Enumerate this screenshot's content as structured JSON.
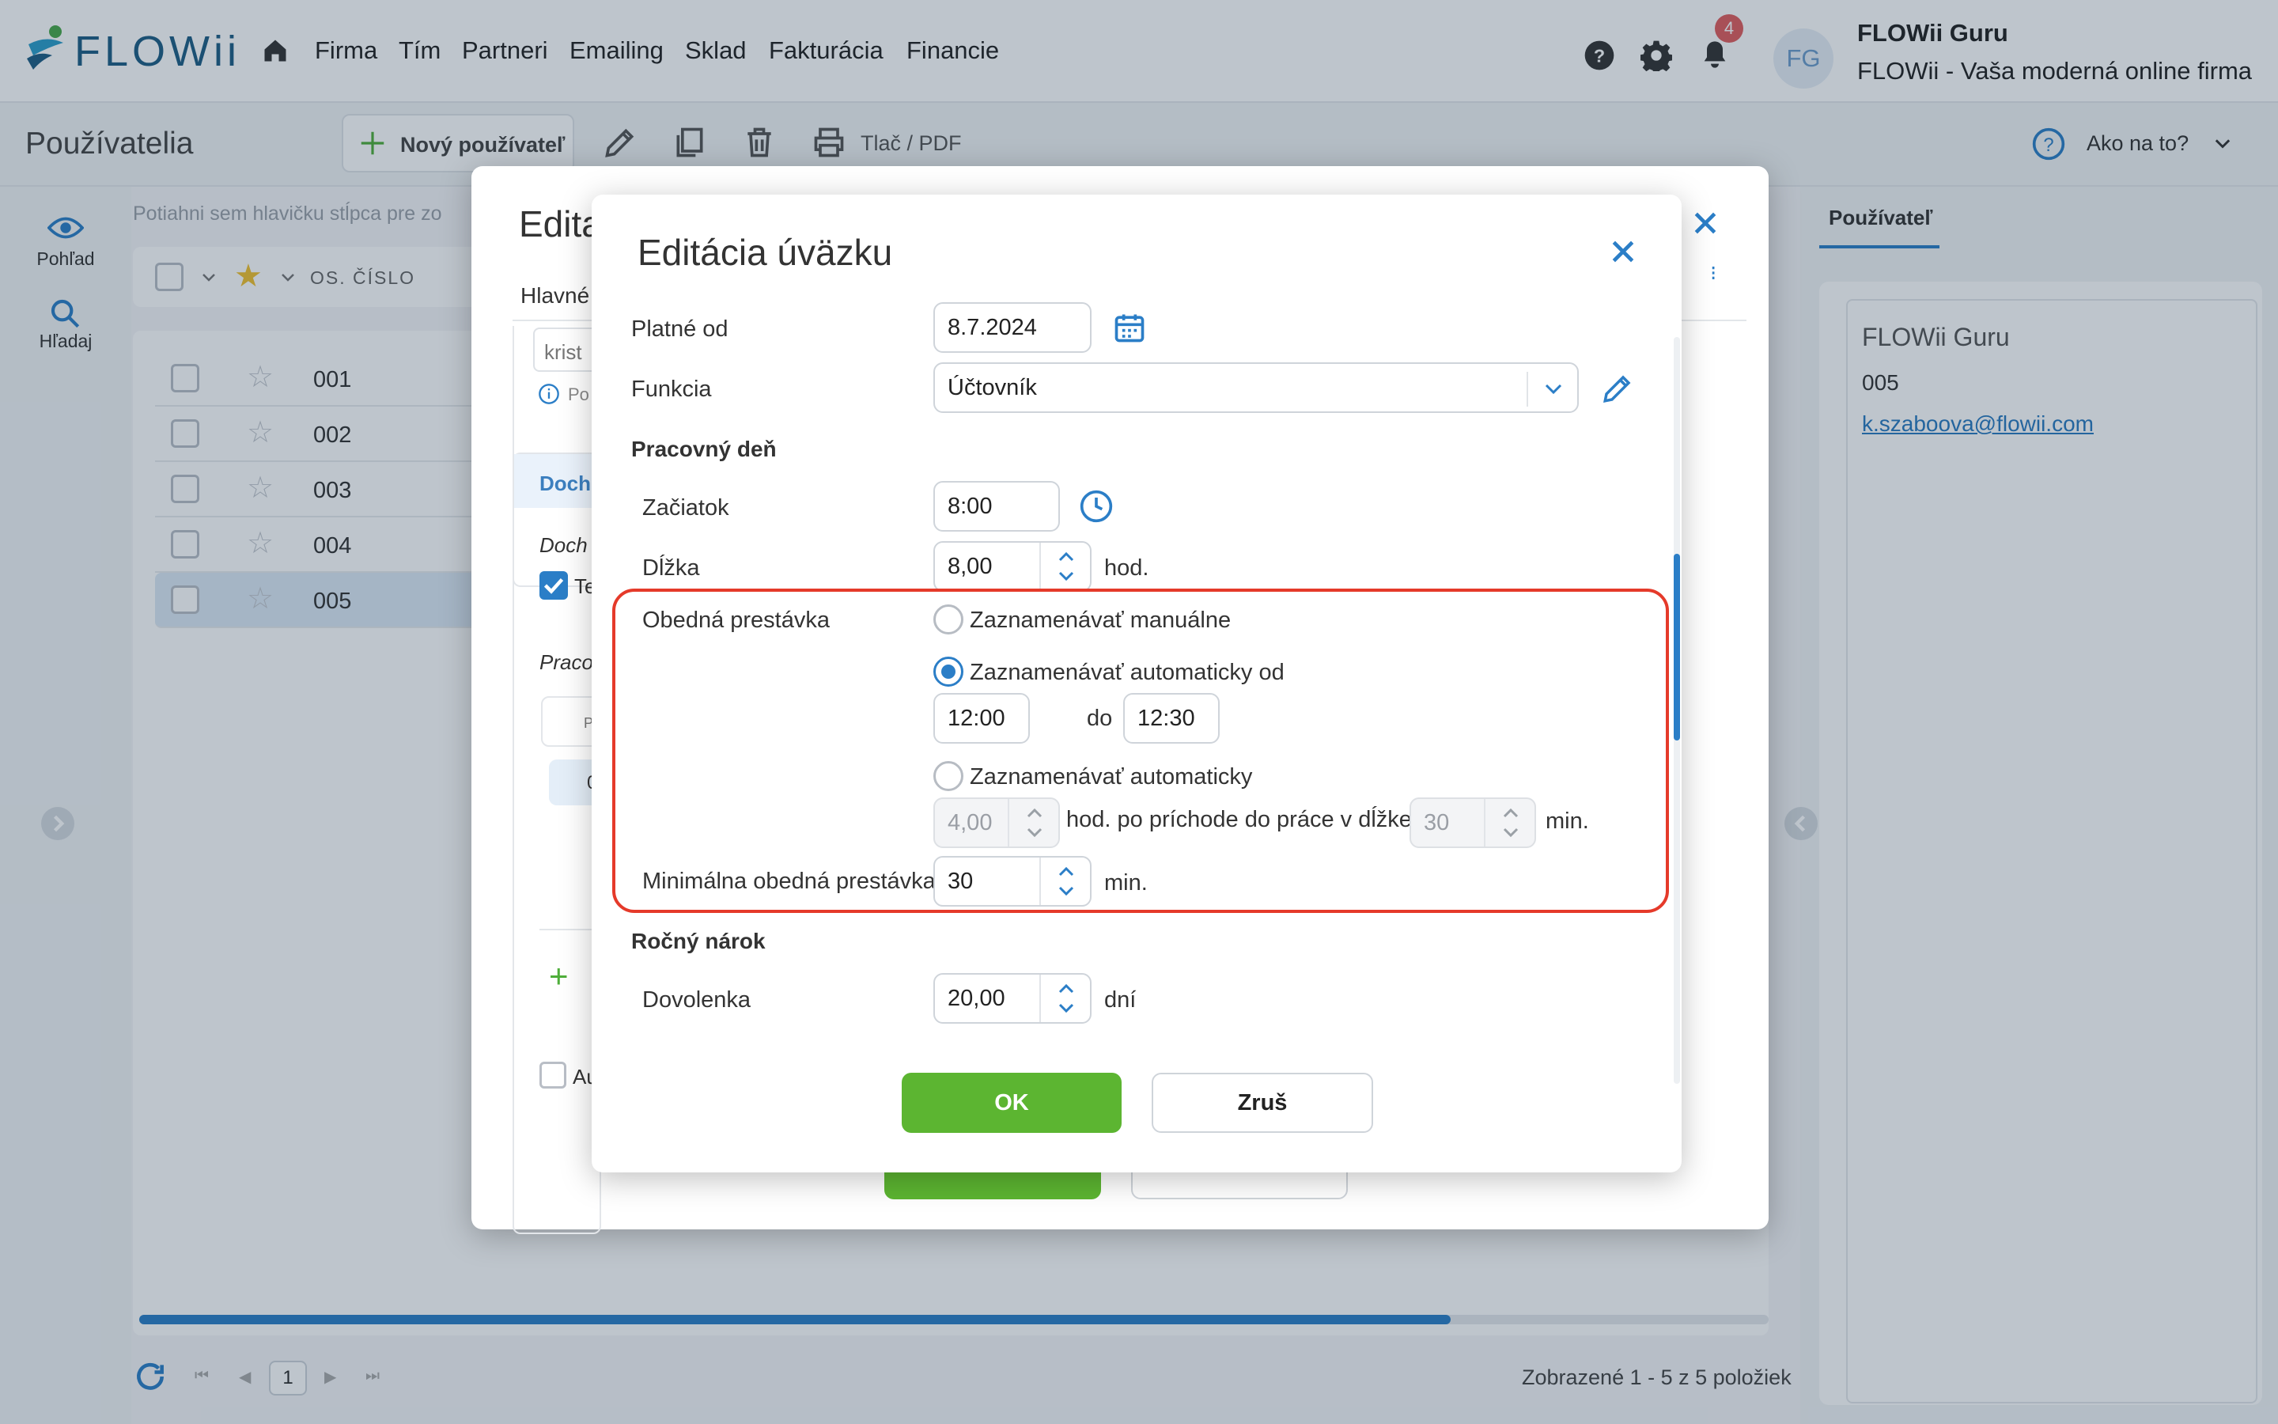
{
  "app": {
    "logo": "FLOWii",
    "nav": [
      "Firma",
      "Tím",
      "Partneri",
      "Emailing",
      "Sklad",
      "Fakturácia",
      "Financie"
    ],
    "notifications": "4",
    "avatar": "FG",
    "user_name": "FLOWii Guru",
    "company": "FLOWii - Vaša moderná online firma"
  },
  "toolbar": {
    "title": "Používatelia",
    "new_user": "Nový používateľ",
    "print": "Tlač / PDF",
    "help": "Ako na to?"
  },
  "sidebar": {
    "view": "Pohľad",
    "search": "Hľadaj"
  },
  "grid": {
    "drag_hint": "Potiahni sem hlavičku stĺpca pre zo",
    "col_code": "OS. ČÍSLO",
    "rows": [
      "001",
      "002",
      "003",
      "004",
      "005"
    ],
    "footer": "Zobrazené 1 - 5 z 5 položiek",
    "page": "1"
  },
  "right_panel": {
    "tab": "Používateľ",
    "name": "FLOWii Guru",
    "code": "005",
    "email": "k.szaboova@flowii.com"
  },
  "outer_dialog": {
    "title": "Edita",
    "tab": "Hlavné",
    "field_value": "krist",
    "info": "Po",
    "section": "Doch",
    "subsection": "Doch",
    "checkbox_label": "Te",
    "work": "Praco",
    "cell1": "P",
    "cell2": "0",
    "bottom_checkbox": "Au",
    "add": "+"
  },
  "dialog": {
    "title": "Editácia úväzku",
    "valid_from_label": "Platné od",
    "valid_from": "8.7.2024",
    "function_label": "Funkcia",
    "function": "Účtovník",
    "workday_section": "Pracovný deň",
    "start_label": "Začiatok",
    "start": "8:00",
    "length_label": "Dĺžka",
    "length": "8,00",
    "length_unit": "hod.",
    "lunch_label": "Obedná prestávka",
    "opt_manual": "Zaznamenávať manuálne",
    "opt_auto_from": "Zaznamenávať automaticky od",
    "from": "12:00",
    "to_label": "do",
    "to": "12:30",
    "opt_auto": "Zaznamenávať automaticky",
    "auto_hours": "4,00",
    "auto_text": "hod. po príchode do práce v dĺžke",
    "auto_minutes": "30",
    "min_unit": "min.",
    "min_lunch_label": "Minimálna obedná prestávka",
    "min_lunch": "30",
    "annual_section": "Ročný nárok",
    "vacation_label": "Dovolenka",
    "vacation": "20,00",
    "vacation_unit": "dní",
    "ok": "OK",
    "cancel": "Zruš",
    "selected_option": "auto_from"
  },
  "colors": {
    "accent": "#2b7ec7",
    "ok": "#5cb531",
    "highlight": "#e53a2a"
  }
}
